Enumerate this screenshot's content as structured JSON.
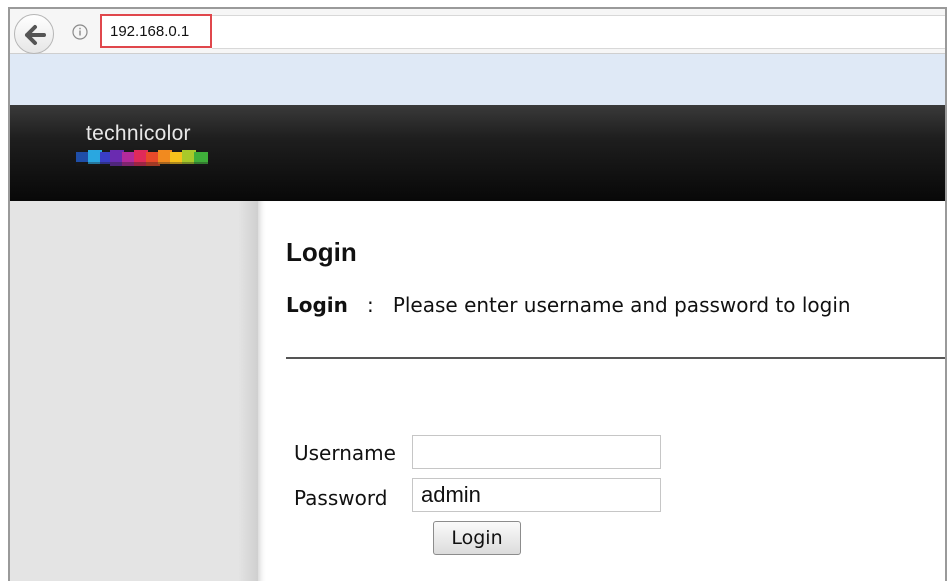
{
  "browser": {
    "url": "192.168.0.1"
  },
  "header": {
    "brand": "technicolor"
  },
  "main": {
    "title": "Login",
    "instruction_label": "Login",
    "instruction_separator": ":",
    "instruction_text": "Please enter username and password to login",
    "form": {
      "username_label": "Username",
      "username_value": "",
      "password_label": "Password",
      "password_value": "admin",
      "submit_label": "Login"
    }
  },
  "colors": {
    "url_highlight": "#e0474c",
    "header_bg": "#141414",
    "sidebar_bg": "#e4e4e4",
    "toolbar_strip": "#dfe9f6"
  }
}
